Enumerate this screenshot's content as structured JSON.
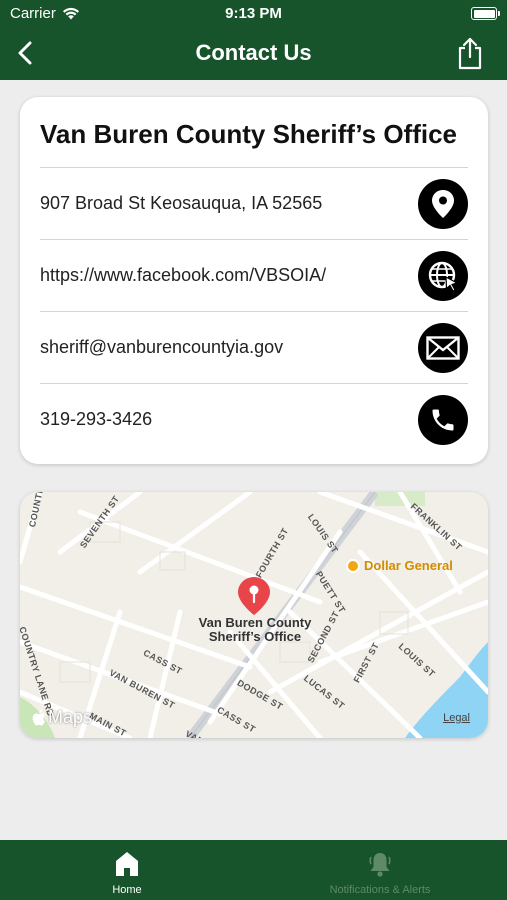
{
  "status_bar": {
    "carrier": "Carrier",
    "time": "9:13 PM"
  },
  "nav": {
    "title": "Contact Us",
    "back_icon": "chevron-left-icon",
    "share_icon": "share-icon"
  },
  "contact": {
    "name": "Van Buren County Sheriff’s Office",
    "rows": [
      {
        "text": "907 Broad St Keosauqua, IA 52565",
        "icon": "map-pin-icon"
      },
      {
        "text": "https://www.facebook.com/VBSOIA/",
        "icon": "globe-icon"
      },
      {
        "text": "sheriff@vanburencountyia.gov",
        "icon": "mail-icon"
      },
      {
        "text": "319-293-3426",
        "icon": "phone-icon"
      }
    ]
  },
  "map": {
    "pin_label_line1": "Van Buren County",
    "pin_label_line2": "Sheriff’s Office",
    "poi": "Dollar General",
    "maps_brand": "Maps",
    "legal": "Legal",
    "streets": [
      "COUNTRY",
      "SEVENTH ST",
      "FOURTH ST",
      "LOUIS ST",
      "FRANKLIN ST",
      "PUETT ST",
      "COUNTRY LANE RD",
      "CASS ST",
      "SECOND ST",
      "VAN BUREN ST",
      "DODGE ST",
      "LUCAS ST",
      "FIRST ST",
      "LOUIS ST",
      "MAIN ST",
      "CASS ST",
      "VAN BU"
    ]
  },
  "tabs": [
    {
      "label": "Home",
      "icon": "home-icon",
      "active": true
    },
    {
      "label": "Notifications & Alerts",
      "icon": "bell-icon",
      "active": false
    }
  ],
  "colors": {
    "brand_green": "#17532b",
    "pin_red": "#e8454b",
    "poi_orange": "#f3a60f"
  }
}
